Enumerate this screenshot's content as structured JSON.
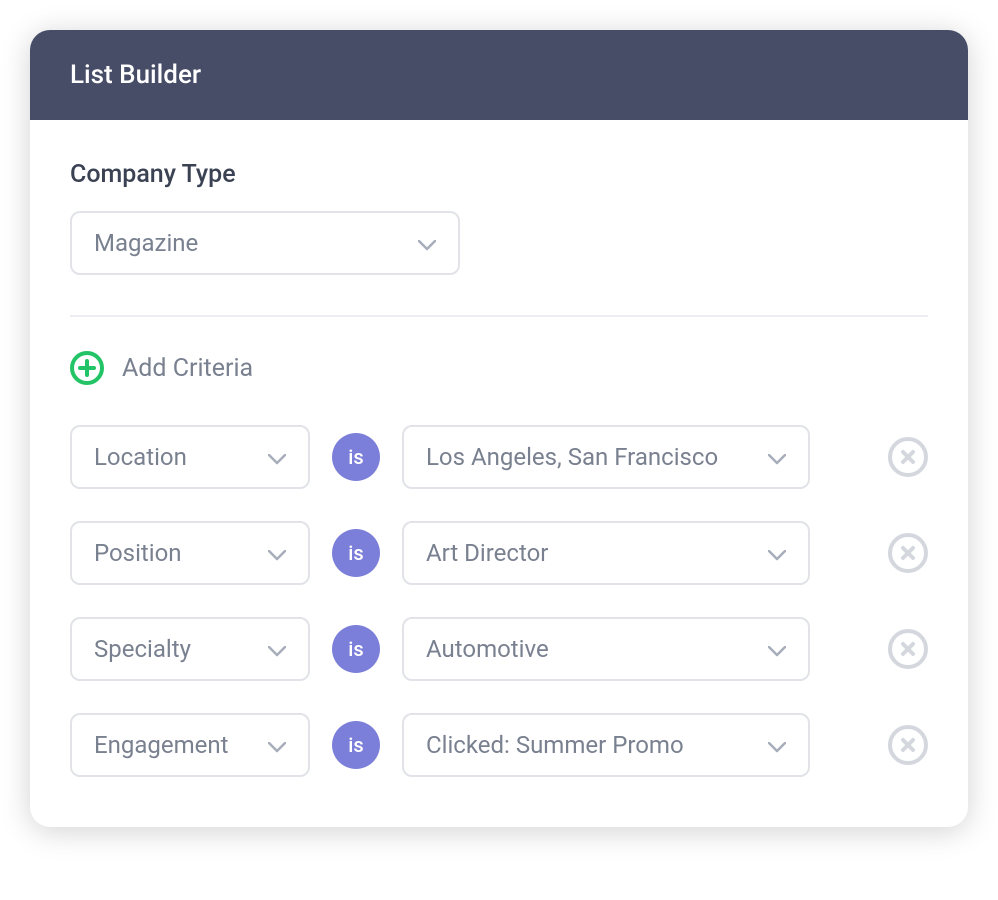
{
  "header": {
    "title": "List Builder"
  },
  "company_type": {
    "label": "Company Type",
    "value": "Magazine"
  },
  "add_criteria": {
    "label": "Add Criteria"
  },
  "operator": "is",
  "criteria": [
    {
      "field": "Location",
      "value": "Los Angeles, San Francisco"
    },
    {
      "field": "Position",
      "value": "Art Director"
    },
    {
      "field": "Specialty",
      "value": "Automotive"
    },
    {
      "field": "Engagement",
      "value": "Clicked: Summer Promo"
    }
  ]
}
